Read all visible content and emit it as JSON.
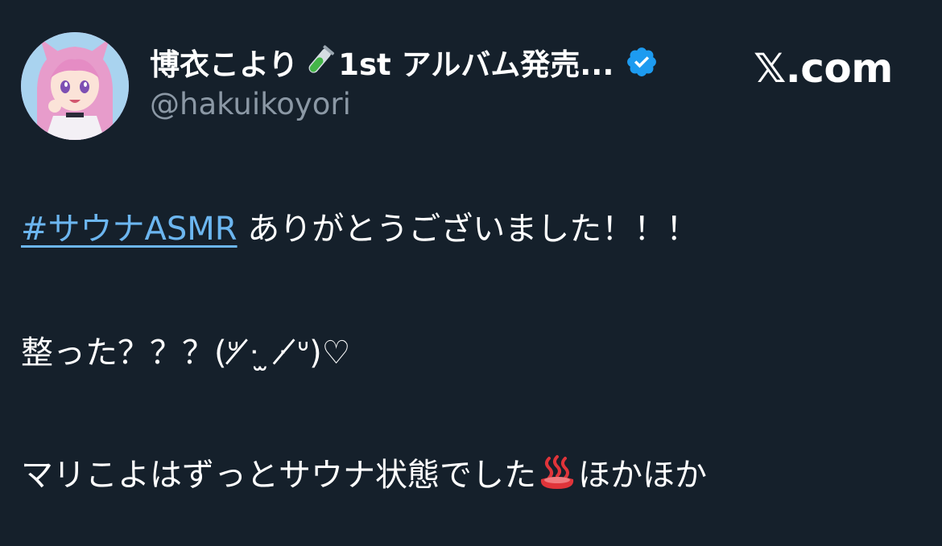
{
  "header": {
    "display_name": "博衣こより",
    "album_text": "1st アルバム発売...",
    "handle": "@hakuikoyori",
    "brand": "𝕏.com"
  },
  "icons": {
    "avatar": "avatar",
    "test_tube": "test-tube-icon",
    "verified": "verified-badge-icon",
    "hot_springs": "hot-springs-icon"
  },
  "tweet": {
    "hashtag": "#サウナASMR",
    "line1_rest": " ありがとうございました！！！",
    "line2": "整った？？？(ᐡ ̸̸ᐧ ̫ ᐧ ̸̸ᐡ)♡",
    "line3_before": "マリこよはずっとサウナ状態でした",
    "line3_after": "ほかほか"
  },
  "colors": {
    "background": "#15202b",
    "text": "#ffffff",
    "muted": "#8b98a5",
    "link": "#6cb6f0",
    "verified": "#1d9bf0"
  }
}
